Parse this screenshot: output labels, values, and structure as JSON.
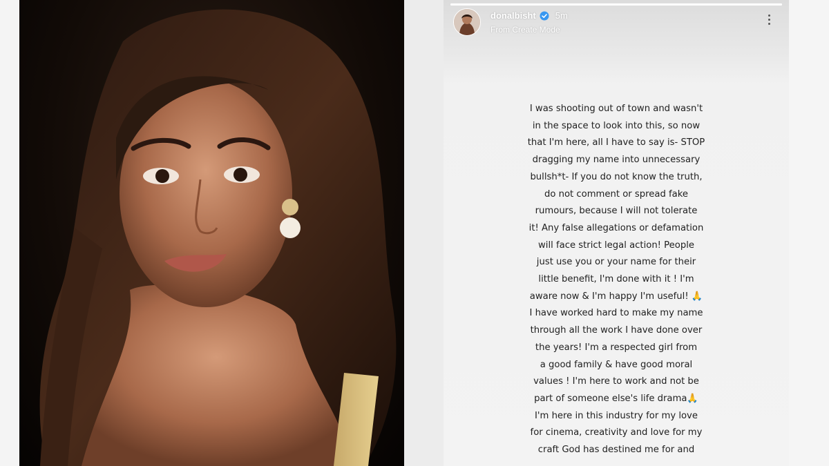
{
  "story": {
    "username": "donalbisht",
    "time_ago": "5m",
    "subtitle": "From Create Mode",
    "progress": 1.0,
    "icons": {
      "verified": "verified-badge-icon",
      "more": "more-options-icon"
    },
    "colors": {
      "verified": "#3897f0",
      "text": "#1f1f1f"
    },
    "message_lines": [
      "I was shooting out of town and wasn't",
      "in the space to look into this, so now",
      "that I'm here, all I have to say is- STOP",
      "dragging my name into unnecessary",
      "bullsh*t- If you do not know the truth,",
      "do not comment or spread fake",
      "rumours, because I will not tolerate",
      "it! Any false allegations or defamation",
      "will face strict legal action! People",
      "just use you or your name for their",
      "little benefit, I'm done with it ! I'm",
      "aware now & I'm happy I'm useful! 🙏",
      "I have worked hard to make my name",
      "through all the work I have done over",
      "the years! I'm a respected girl from",
      "a good family & have good moral",
      "values ! I'm here to work and not be",
      "part of someone else's life drama🙏",
      "I'm here in this industry for my love",
      "for cinema, creativity and love for my",
      "craft God has destined me for and"
    ]
  }
}
